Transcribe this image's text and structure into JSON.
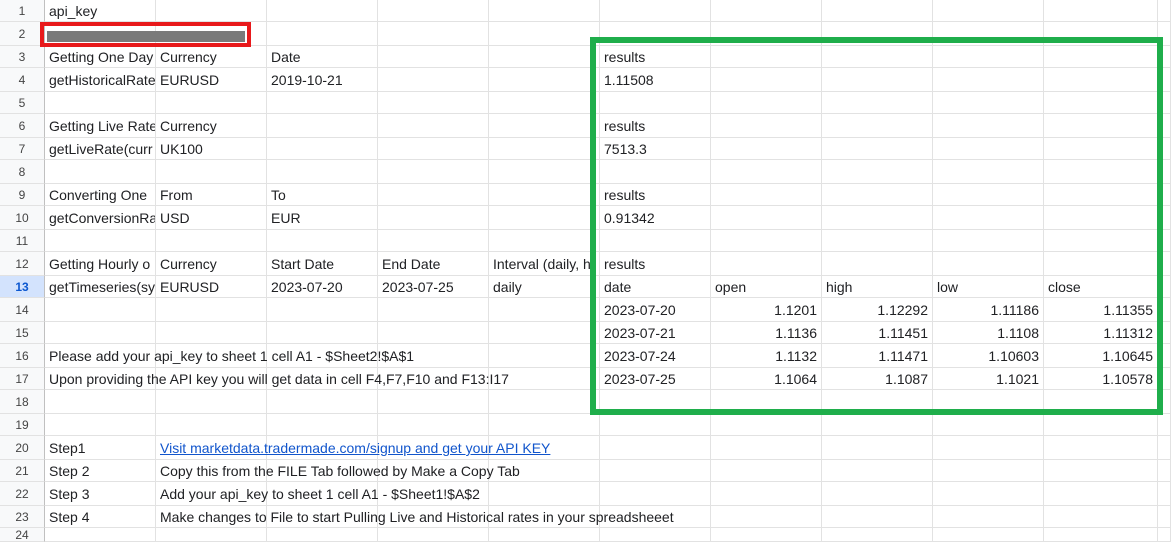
{
  "row_numbers": [
    "1",
    "2",
    "3",
    "4",
    "5",
    "6",
    "7",
    "8",
    "9",
    "10",
    "11",
    "12",
    "13",
    "14",
    "15",
    "16",
    "17",
    "18",
    "19",
    "20",
    "21",
    "22",
    "23",
    "24"
  ],
  "selected_row": "13",
  "redaction": {
    "label": "api key value (redacted)"
  },
  "highlight": {
    "color": "#1fae4b",
    "red": "#e8191b"
  },
  "sheet": {
    "r1": {
      "a": "api_key"
    },
    "r3": {
      "a": "Getting One Day",
      "b": "Currency",
      "c": "Date",
      "f": "results"
    },
    "r4": {
      "a": "getHistoricalRate",
      "b": "EURUSD",
      "c": "2019-10-21",
      "f": "1.11508"
    },
    "r6": {
      "a": "Getting Live Rate",
      "b": "Currency",
      "f": "results"
    },
    "r7": {
      "a": "getLiveRate(curr",
      "b": "UK100",
      "f": "7513.3"
    },
    "r9": {
      "a": "Converting One",
      "b": "From",
      "c": "To",
      "f": "results"
    },
    "r10": {
      "a": "getConversionRa",
      "b": "USD",
      "c": "EUR",
      "f": "0.91342"
    },
    "r12": {
      "a": "Getting Hourly o",
      "b": "Currency",
      "c": "Start Date",
      "d": "End Date",
      "e": "Interval (daily, h",
      "f": "results"
    },
    "r13": {
      "a": "getTimeseries(sy",
      "b": "EURUSD",
      "c": "2023-07-20",
      "d": "2023-07-25",
      "e": "daily",
      "f": "date",
      "g": "open",
      "h": "high",
      "i": "low",
      "j": "close"
    },
    "r14": {
      "f": "2023-07-20",
      "g": "1.1201",
      "h": "1.12292",
      "i": "1.11186",
      "j": "1.11355"
    },
    "r15": {
      "f": "2023-07-21",
      "g": "1.1136",
      "h": "1.11451",
      "i": "1.1108",
      "j": "1.11312"
    },
    "r16": {
      "a": "Please add your api_key to sheet 1 cell A1 - $Sheet2!$A$1",
      "f": "2023-07-24",
      "g": "1.1132",
      "h": "1.11471",
      "i": "1.10603",
      "j": "1.10645"
    },
    "r17": {
      "a": "Upon providing the API key you will get data in cell F4,F7,F10 and F13:I17",
      "f": "2023-07-25",
      "g": "1.1064",
      "h": "1.1087",
      "i": "1.1021",
      "j": "1.10578"
    },
    "r20": {
      "a": "Step1",
      "b": "Visit marketdata.tradermade.com/signup and get your API KEY"
    },
    "r21": {
      "a": "Step 2",
      "b": "Copy this from the FILE Tab followed by Make a Copy Tab"
    },
    "r22": {
      "a": "Step 3",
      "b": "Add your api_key to sheet 1 cell A1 - $Sheet1!$A$2"
    },
    "r23": {
      "a": "Step 4",
      "b": "Make changes to File to start Pulling Live and Historical rates in your spreadsheeet"
    }
  }
}
